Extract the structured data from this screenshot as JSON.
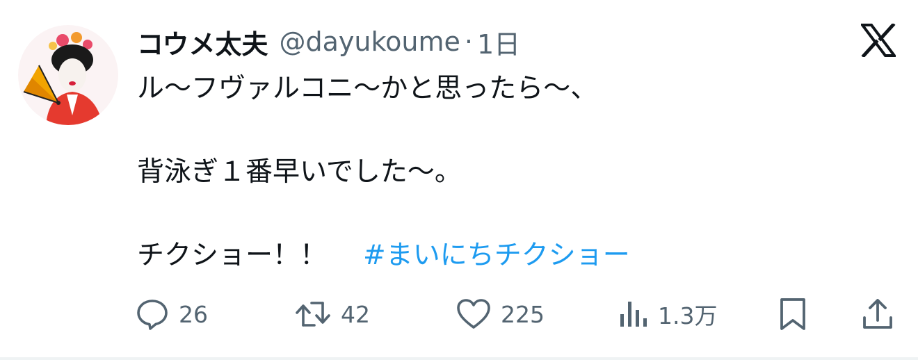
{
  "author": {
    "display_name": "コウメ太夫",
    "handle": "@dayukoume",
    "separator": "·",
    "time": "1日"
  },
  "tweet": {
    "line1": "ル〜フヴァルコニ〜かと思ったら〜、",
    "line2": "背泳ぎ１番早いでした〜。",
    "line3": "チクショー！！",
    "hashtag": "#まいにちチクショー"
  },
  "actions": {
    "replies": "26",
    "reposts": "42",
    "likes": "225",
    "views": "1.3万"
  },
  "icons": {
    "platform": "x-logo-icon",
    "reply": "speech-bubble-icon",
    "repost": "repost-arrows-icon",
    "like": "heart-icon",
    "views": "bar-chart-icon",
    "bookmark": "bookmark-icon",
    "share": "share-upload-icon"
  },
  "colors": {
    "text": "#0f1419",
    "secondary": "#536471",
    "link": "#1d9bf0"
  }
}
